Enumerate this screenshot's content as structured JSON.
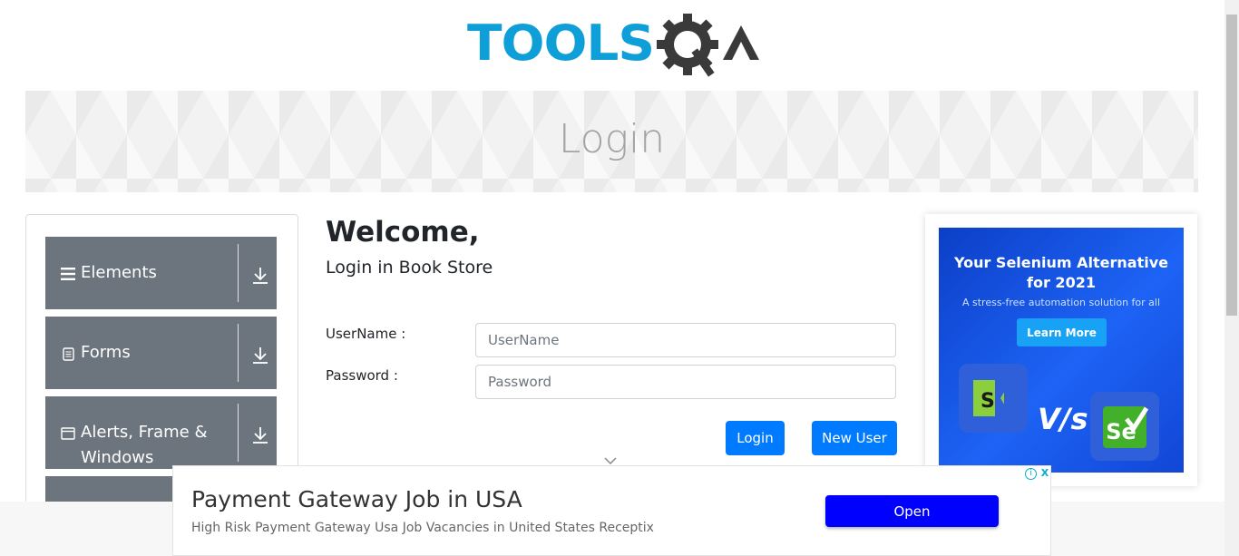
{
  "logo": {
    "part1": "TOOLS",
    "part2": "QA"
  },
  "banner": {
    "title": "Login"
  },
  "sidebar": {
    "groups": [
      {
        "label": "Elements",
        "icon": "hamburger-icon"
      },
      {
        "label": "Forms",
        "icon": "document-icon"
      },
      {
        "label": "Alerts, Frame &",
        "label2": "Windows",
        "icon": "window-icon"
      }
    ]
  },
  "main": {
    "heading": "Welcome,",
    "subheading": "Login in Book Store",
    "username_label": "UserName :",
    "username_placeholder": "UserName",
    "password_label": "Password :",
    "password_placeholder": "Password",
    "login_button": "Login",
    "new_user_button": "New User"
  },
  "ad_right": {
    "headline_1": "Your Selenium Alternative",
    "headline_2": "for 2021",
    "tagline": "A stress-free automation solution for all",
    "cta": "Learn More",
    "versus": "V/s",
    "selenium_tile_text": "Se"
  },
  "ad_bottom": {
    "title": "Payment Gateway Job in USA",
    "description": "High Risk Payment Gateway Usa Job Vacancies in United States Receptix",
    "open_button": "Open",
    "info": "i",
    "close": "X"
  },
  "colors": {
    "logo_blue": "#0e9ed8",
    "logo_dark": "#3a3a3a",
    "sidebar_group": "#6c757d",
    "primary_button": "#007bff",
    "ad_open_button": "#0000ff"
  }
}
